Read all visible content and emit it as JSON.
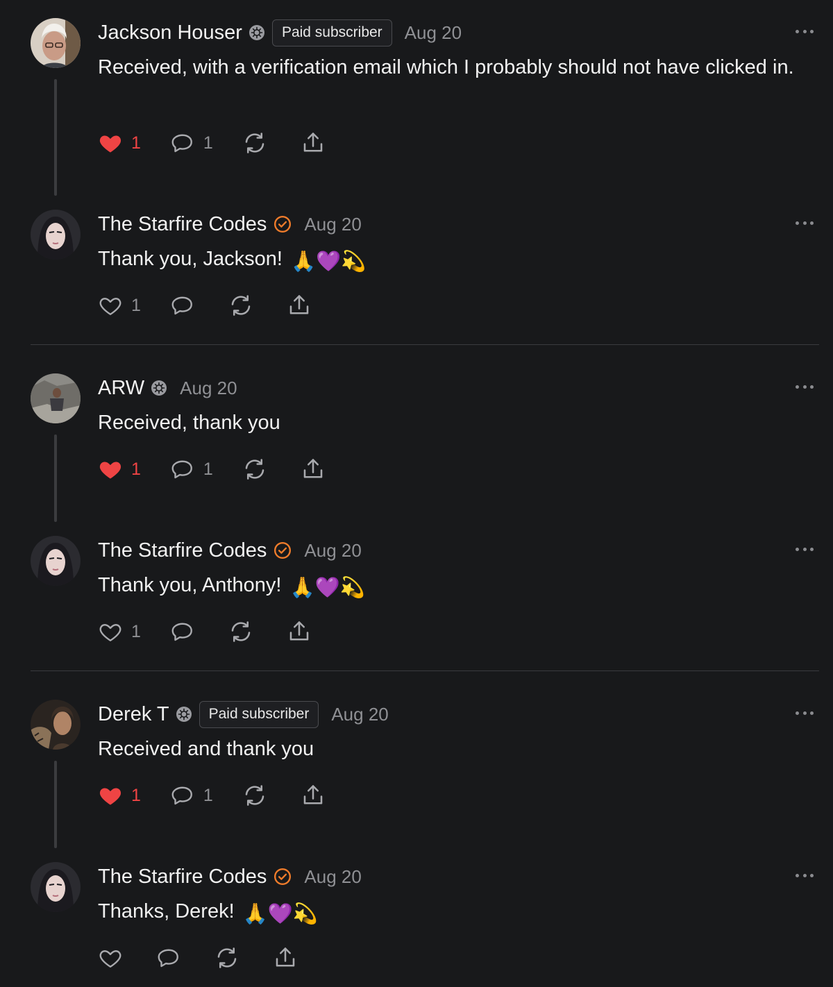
{
  "colors": {
    "background": "#18191b",
    "like_red": "#ef4444",
    "verified_orange": "#f07c2b",
    "muted": "#8f9094"
  },
  "comments": [
    {
      "author": "Jackson Houser",
      "badge": "Paid subscriber",
      "date": "Aug 20",
      "text": "Received, with a verification email which I probably should not have clicked in.",
      "likes": "1",
      "liked": true,
      "replies": "1",
      "icon": "subscriber-icon"
    },
    {
      "author": "The Starfire Codes",
      "date": "Aug 20",
      "text": "Thank you, Jackson! ",
      "emoji": "🙏💜💫",
      "likes": "1",
      "liked": false,
      "replies": "",
      "icon": "verified-check-icon"
    },
    {
      "author": "ARW",
      "date": "Aug 20",
      "text": "Received, thank you",
      "likes": "1",
      "liked": true,
      "replies": "1",
      "icon": "subscriber-icon"
    },
    {
      "author": "The Starfire Codes",
      "date": "Aug 20",
      "text": "Thank you, Anthony! ",
      "emoji": "🙏💜💫",
      "likes": "1",
      "liked": false,
      "replies": "",
      "icon": "verified-check-icon"
    },
    {
      "author": "Derek T",
      "badge": "Paid subscriber",
      "date": "Aug 20",
      "text": "Received and thank you",
      "likes": "1",
      "liked": true,
      "replies": "1",
      "icon": "subscriber-icon"
    },
    {
      "author": "The Starfire Codes",
      "date": "Aug 20",
      "text": "Thanks, Derek! ",
      "emoji": "🙏💜💫",
      "likes": "",
      "liked": false,
      "replies": "",
      "icon": "verified-check-icon"
    }
  ]
}
